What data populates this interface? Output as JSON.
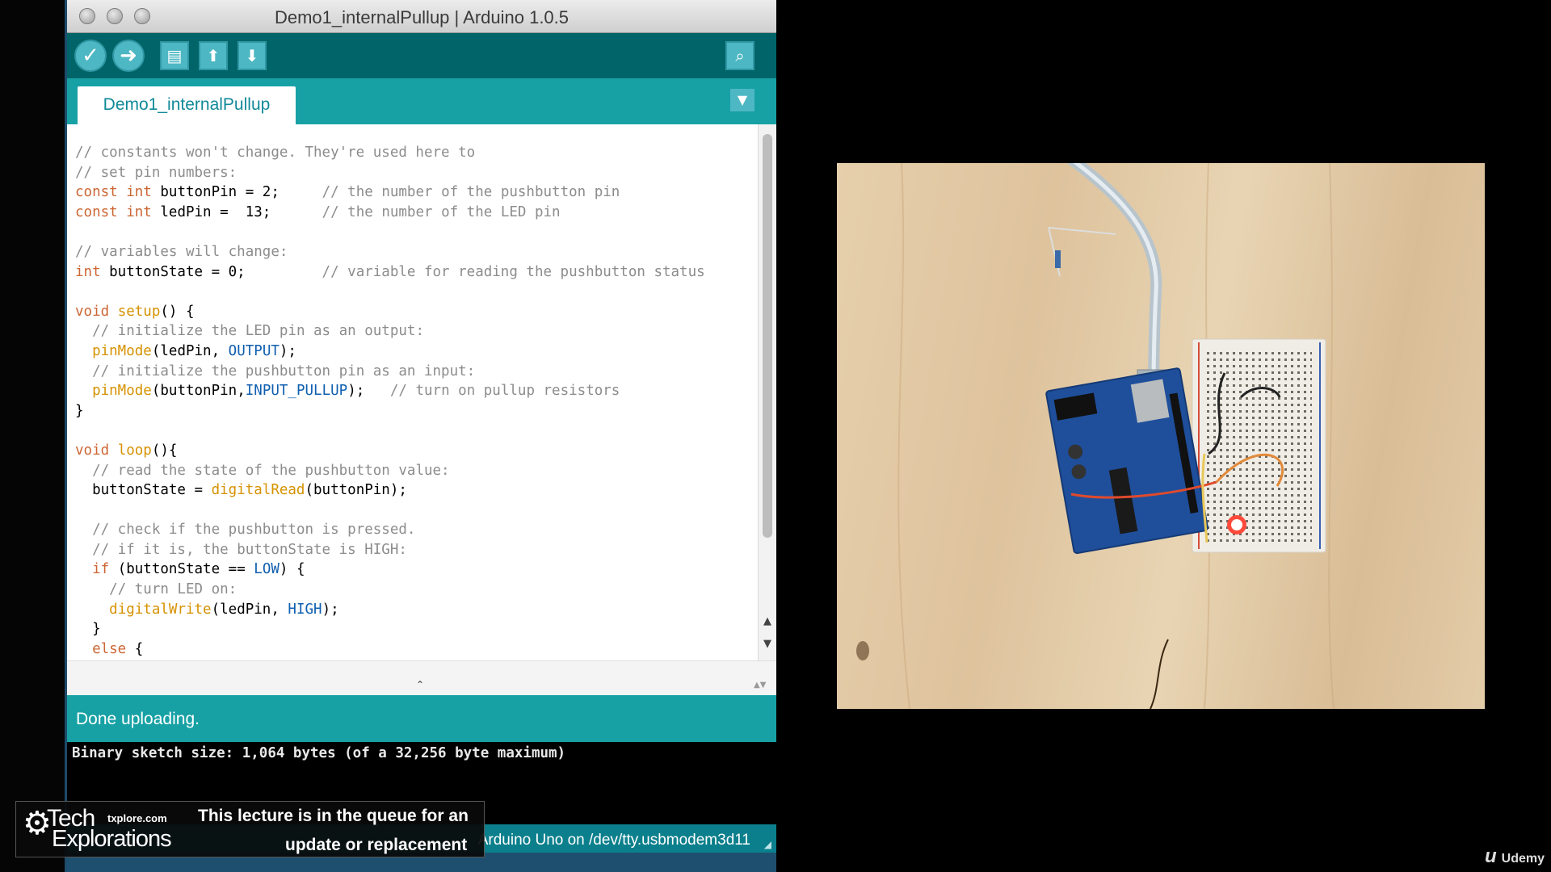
{
  "window": {
    "title": "Demo1_internalPullup | Arduino 1.0.5",
    "toolbar": {
      "verify_icon": "check-icon",
      "upload_icon": "arrow-right-icon",
      "new_icon": "new-file-icon",
      "open_icon": "open-arrow-up-icon",
      "save_icon": "save-arrow-down-icon",
      "serial_monitor_icon": "magnifier-icon"
    },
    "tab": {
      "label": "Demo1_internalPullup"
    },
    "status": "Done uploading.",
    "console": "Binary sketch size: 1,064 bytes (of a 32,256 byte maximum)",
    "board_info": "Arduino Uno on /dev/tty.usbmodem3d11"
  },
  "code_lines": [
    "// constants won't change. They're used here to",
    "// set pin numbers:",
    "const int buttonPin = 2;     // the number of the pushbutton pin",
    "const int ledPin =  13;      // the number of the LED pin",
    "",
    "// variables will change:",
    "int buttonState = 0;         // variable for reading the pushbutton status",
    "",
    "void setup() {",
    "  // initialize the LED pin as an output:",
    "  pinMode(ledPin, OUTPUT);",
    "  // initialize the pushbutton pin as an input:",
    "  pinMode(buttonPin,INPUT_PULLUP);   // turn on pullup resistors",
    "}",
    "",
    "void loop(){",
    "  // read the state of the pushbutton value:",
    "  buttonState = digitalRead(buttonPin);",
    "",
    "  // check if the pushbutton is pressed.",
    "  // if it is, the buttonState is HIGH:",
    "  if (buttonState == LOW) {",
    "    // turn LED on:",
    "    digitalWrite(ledPin, HIGH);",
    "  }",
    "  else {"
  ],
  "watermark": {
    "brand_line1": "Tech",
    "brand_line2": "Explorations",
    "site": "txplore.com",
    "message_line1": "This lecture is in the queue for an",
    "message_line2": "update or replacement"
  },
  "udemy_label": "Udemy",
  "colors": {
    "toolbar": "#006468",
    "tabbar": "#17a1a5",
    "keyword": "#cc6633",
    "function": "#d69200",
    "constant": "#0f5fb0",
    "comment": "#8c8c8c"
  }
}
